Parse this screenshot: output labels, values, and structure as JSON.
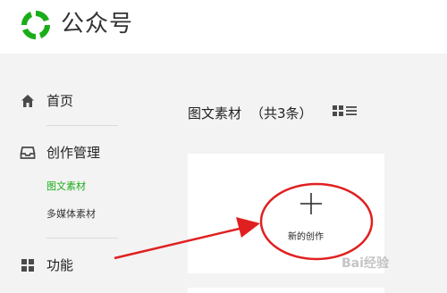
{
  "header": {
    "brand": "公众号"
  },
  "sidebar": {
    "items": [
      {
        "label": "首页",
        "icon": "home-icon"
      },
      {
        "label": "创作管理",
        "icon": "inbox-icon"
      },
      {
        "label": "功能",
        "icon": "grid-icon"
      }
    ],
    "sub_items": [
      {
        "label": "图文素材",
        "active": true
      },
      {
        "label": "多媒体素材",
        "active": false
      }
    ]
  },
  "main": {
    "title": "图文素材",
    "count": "（共3条）",
    "create_label": "新的创作"
  },
  "watermark": "Bai经验",
  "colors": {
    "accent": "#1aad19",
    "annotation": "#e02020"
  }
}
